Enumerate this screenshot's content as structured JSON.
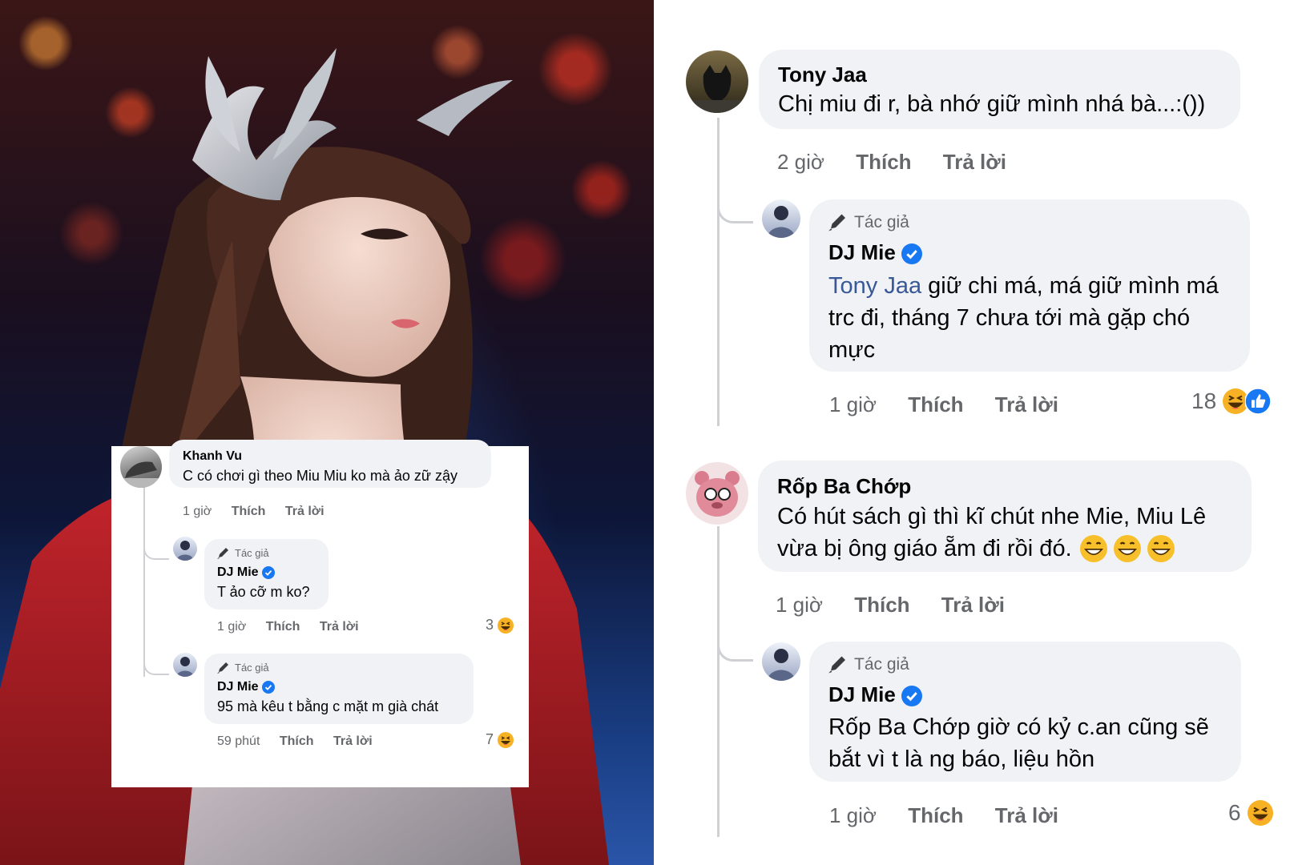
{
  "inset": {
    "comment": {
      "name": "Khanh Vu",
      "text": "C có chơi gì theo Miu Miu ko mà ảo zữ zậy",
      "time": "1 giờ",
      "like": "Thích",
      "reply": "Trả lời"
    },
    "replies": [
      {
        "author_badge": "Tác giả",
        "name": "DJ Mie",
        "text": "T ảo cỡ m ko?",
        "time": "1 giờ",
        "like": "Thích",
        "reply": "Trả lời",
        "reaction_count": "3"
      },
      {
        "author_badge": "Tác giả",
        "name": "DJ Mie",
        "text": "95 mà kêu t bằng c mặt m già chát",
        "time": "59 phút",
        "like": "Thích",
        "reply": "Trả lời",
        "reaction_count": "7"
      }
    ]
  },
  "thread1": {
    "comment": {
      "name": "Tony Jaa",
      "text": "Chị miu đi r, bà nhớ giữ mình nhá bà...:())",
      "time": "2 giờ",
      "like": "Thích",
      "reply": "Trả lời"
    },
    "reply": {
      "author_badge": "Tác giả",
      "name": "DJ Mie",
      "mention": "Tony Jaa",
      "line1": " giữ chi má, má giữ mình má",
      "line2": "trc đi, tháng 7 chưa tới mà gặp chó",
      "line3": "mực",
      "time": "1 giờ",
      "like": "Thích",
      "reply": "Trả lời",
      "reaction_count": "18"
    }
  },
  "thread2": {
    "comment": {
      "name": "Rốp Ba Chớp",
      "line1": "Có hút sách gì thì kĩ chút nhe Mie,  Miu Lê",
      "line2": "vừa bị ông giáo ẵm đi rồi đó.",
      "time": "1 giờ",
      "like": "Thích",
      "reply": "Trả lời"
    },
    "reply": {
      "author_badge": "Tác giả",
      "name": "DJ Mie",
      "line1": "Rốp Ba Chớp giờ có kỷ c.an cũng sẽ",
      "line2": "bắt vì t là ng báo, liệu hồn",
      "time": "1 giờ",
      "like": "Thích",
      "reply": "Trả lời",
      "reaction_count": "6"
    }
  },
  "icons": {
    "verified": "verified-badge-icon",
    "author": "pencil-icon",
    "haha": "haha-reaction-icon",
    "like": "like-reaction-icon"
  },
  "colors": {
    "bubble": "#f0f2f5",
    "meta": "#65676b",
    "mention": "#385898",
    "verified": "#1877f2"
  }
}
